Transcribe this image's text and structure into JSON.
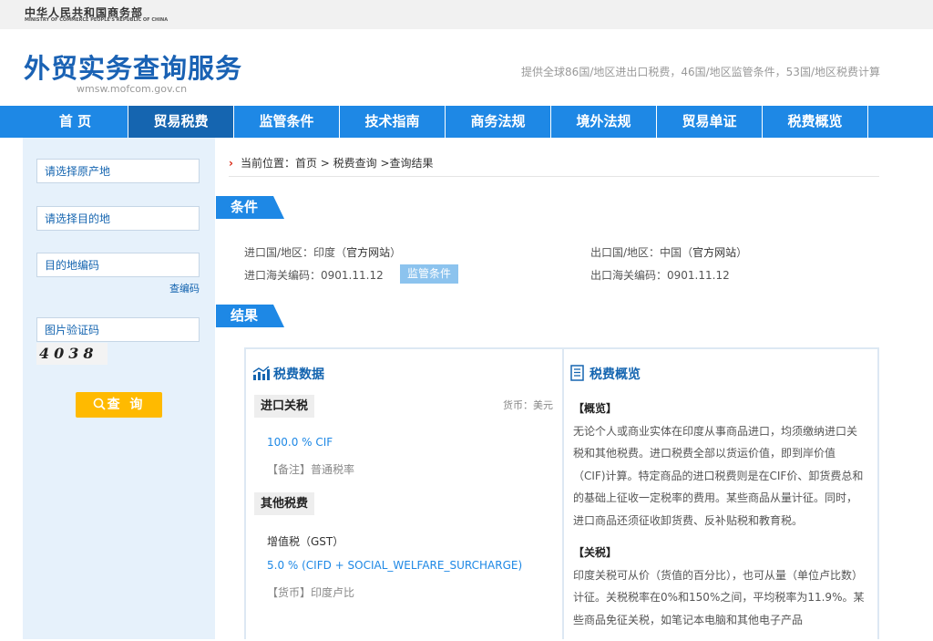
{
  "ministry": {
    "cn": "中华人民共和国商务部",
    "en": "MINISTRY OF COMMERCE PEOPLE'S REPUBLIC OF CHINA"
  },
  "header": {
    "title": "外贸实务查询服务",
    "domain": "wmsw.mofcom.gov.cn",
    "tagline": "提供全球86国/地区进出口税费，46国/地区监管条件，53国/地区税费计算"
  },
  "nav": {
    "items": [
      "首 页",
      "贸易税费",
      "监管条件",
      "技术指南",
      "商务法规",
      "境外法规",
      "贸易单证",
      "税费概览"
    ],
    "active_index": 1
  },
  "sidebar": {
    "origin_placeholder": "请选择原产地",
    "destination_placeholder": "请选择目的地",
    "hs_code_placeholder": "目的地编码",
    "lookup_link": "查编码",
    "captcha_placeholder": "图片验证码",
    "captcha_text": "4038",
    "search_button": "查 询"
  },
  "breadcrumb": "当前位置：首页 > 税费查询 >查询结果",
  "conditions": {
    "section_label": "条件",
    "import_country_label": "进口国/地区：",
    "import_country": "印度",
    "import_official": "官方网站",
    "import_code_label": "进口海关编码：",
    "import_code": "0901.11.12",
    "regulation_badge": "监管条件",
    "export_country_label": "出口国/地区：",
    "export_country": "中国",
    "export_official": "官方网站",
    "export_code_label": "出口海关编码：",
    "export_code": "0901.11.12"
  },
  "results": {
    "section_label": "结果",
    "tax_data_title": "税费数据",
    "import_duty_title": "进口关税",
    "currency": "货币：美元",
    "import_rate": "100.0 % CIF",
    "import_note": "【备注】普通税率",
    "other_tax_title": "其他税费",
    "gst_label": "增值税（GST）",
    "gst_rate": "5.0 % (CIFD + SOCIAL_WELFARE_SURCHARGE)",
    "gst_note": "【货币】印度卢比",
    "overview_title": "税费概览",
    "overview_heading": "【概览】",
    "overview_text": "无论个人或商业实体在印度从事商品进口，均须缴纳进口关税和其他税费。进口税费全部以货运价值，即到岸价值（CIF)计算。特定商品的进口税费则是在CIF价、卸货费总和的基础上征收一定税率的费用。某些商品从量计征。同时，进口商品还须征收卸货费、反补贴税和教育税。",
    "duty_heading": "【关税】",
    "duty_text": "印度关税可从价（货值的百分比），也可从量（单位卢比数）计征。关税税率在0%和150%之间，平均税率为11.9%。某些商品免征关税，如笔记本电脑和其他电子产品"
  }
}
